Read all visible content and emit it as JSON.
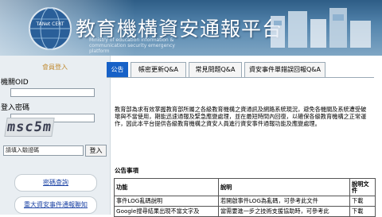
{
  "header": {
    "title": "教育機構資安通報平台",
    "subtitle": "Ministry of education information & communication security emergency platform",
    "logo_text": "TANet CERT"
  },
  "login": {
    "heading": "會員登入",
    "org_label": "機關OID",
    "pwd_label": "登入密碼",
    "captcha_text": "msc5m",
    "captcha_placeholder": "請填入驗證碼",
    "login_button": "登入",
    "query_password": "密碼查詢",
    "incident_contact": "重大資安事件通報聯知"
  },
  "tabs": [
    {
      "label": "公告",
      "active": true
    },
    {
      "label": "帳密更新Q&A",
      "active": false
    },
    {
      "label": "常見問題Q&A",
      "active": false
    },
    {
      "label": "資安事件單錯誤回報Q&A",
      "active": false
    }
  ],
  "intro": "教育部為求有效掌握教育部所屬之各級教育機構之資通訊及網路系統現況，避免各機關及系統遭受破壞與不當使用，期能迅速通報及緊急應變處理，並在最短時間內回復，以確保各級教育機構之正常運作，因此本平台提供各級教育機構之資安人員進行資安事件通報功能及應變處理。",
  "notices": {
    "title": "公告事項",
    "headers": [
      "功能",
      "說明",
      "說明文件"
    ],
    "rows": [
      [
        "事件LOG亂碼說明",
        "若開啟事件LOG為亂碼，可參考此文件",
        "下載"
      ],
      [
        "Google搜尋結果出現不當文字及",
        "當需要進一步之技術支援協助時，可參考此",
        "下載"
      ]
    ]
  },
  "colors": {
    "tab_active": "#1761c7",
    "link": "#1d44a5",
    "login_heading": "#c08a30"
  }
}
